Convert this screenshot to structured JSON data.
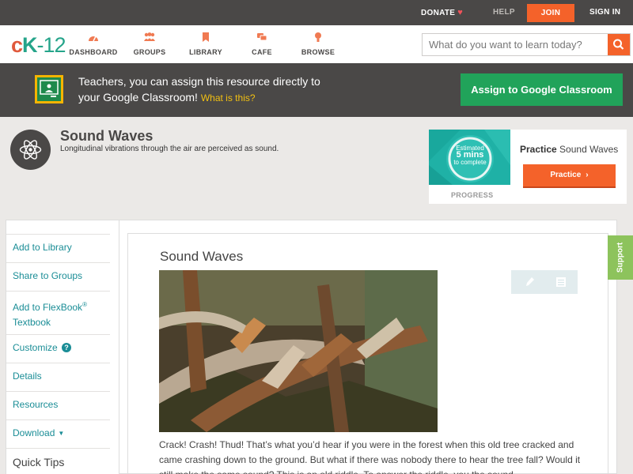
{
  "topbar": {
    "donate": "DONATE",
    "help": "HELP",
    "join": "JOIN",
    "sign_in": "SIGN IN"
  },
  "logo": {
    "c": "c",
    "k": "K",
    "dash": "-",
    "num": "12"
  },
  "nav": {
    "items": [
      {
        "label": "DASHBOARD",
        "icon": "dashboard-icon"
      },
      {
        "label": "GROUPS",
        "icon": "groups-icon"
      },
      {
        "label": "LIBRARY",
        "icon": "library-icon"
      },
      {
        "label": "CAFE",
        "icon": "cafe-icon"
      },
      {
        "label": "BROWSE",
        "icon": "browse-icon"
      }
    ]
  },
  "search": {
    "placeholder": "What do you want to learn today?"
  },
  "banner": {
    "line1": "Teachers, you can assign this resource directly to",
    "line2": "your Google Classroom!",
    "what_link": "What is this?",
    "assign_button": "Assign to Google Classroom"
  },
  "concept": {
    "title": "Sound Waves",
    "description": "Longitudinal vibrations through the air are perceived as sound."
  },
  "progress": {
    "badge_line1": "Estimated",
    "badge_line2": "5 mins",
    "badge_line3": "to complete",
    "label": "PROGRESS",
    "practice_bold": "Practice",
    "practice_topic": "Sound Waves",
    "practice_button": "Practice"
  },
  "sidebar": {
    "add_library": "Add to Library",
    "share_groups": "Share to Groups",
    "add_flexbook": "Add to FlexBook",
    "registered": "®",
    "textbook": "Textbook",
    "customize": "Customize",
    "help_mark": "?",
    "details": "Details",
    "resources": "Resources",
    "download": "Download",
    "download_caret": "▼",
    "quick_tips": "Quick Tips"
  },
  "article": {
    "title": "Sound Waves",
    "paragraph": "Crack! Crash! Thud! That’s what you’d hear if you were in the forest when this old tree cracked and came crashing down to the ground. But what if there was nobody there to hear the tree fall? Would it still make the same sound? This is an old riddle. To answer the riddle, you the sound"
  },
  "support": {
    "label": "Support"
  },
  "colors": {
    "accent_orange": "#f4622a",
    "teal_link": "#1a8d96",
    "dark_bar": "#4a4847",
    "classroom_green": "#21a35a",
    "support_green": "#8dc35c"
  }
}
